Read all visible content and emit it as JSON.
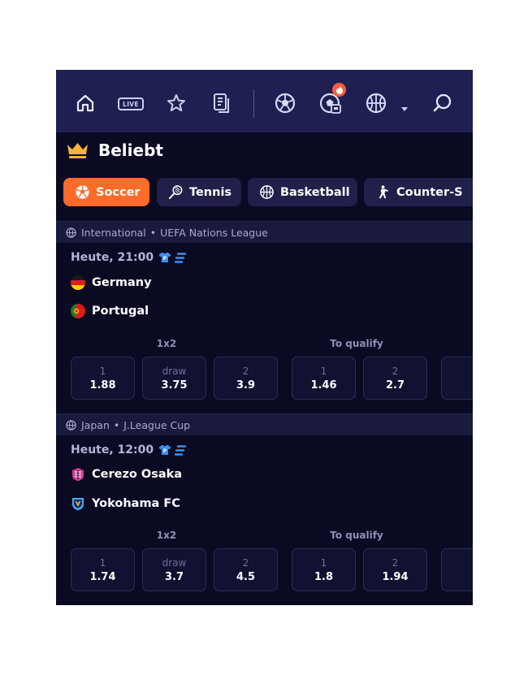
{
  "nav": {
    "live_label": "LIVE"
  },
  "popular": {
    "title": "Beliebt"
  },
  "tabs": [
    {
      "label": "Soccer",
      "icon": "soccer-ball-icon",
      "active": true
    },
    {
      "label": "Tennis",
      "icon": "tennis-icon",
      "active": false
    },
    {
      "label": "Basketball",
      "icon": "basketball-icon",
      "active": false
    },
    {
      "label": "Counter-S",
      "icon": "counter-strike-icon",
      "active": false
    }
  ],
  "matches": [
    {
      "country": "International",
      "separator": "•",
      "league": "UEFA Nations League",
      "time": "Heute, 21:00",
      "home": "Germany",
      "away": "Portugal",
      "market1": {
        "label": "1x2",
        "odds": [
          {
            "label": "1",
            "value": "1.88"
          },
          {
            "label": "draw",
            "value": "3.75"
          },
          {
            "label": "2",
            "value": "3.9"
          }
        ]
      },
      "market2": {
        "label": "To qualify",
        "odds": [
          {
            "label": "1",
            "value": "1.46"
          },
          {
            "label": "2",
            "value": "2.7"
          }
        ]
      }
    },
    {
      "country": "Japan",
      "separator": "•",
      "league": "J.League Cup",
      "time": "Heute, 12:00",
      "home": "Cerezo Osaka",
      "away": "Yokohama FC",
      "market1": {
        "label": "1x2",
        "odds": [
          {
            "label": "1",
            "value": "1.74"
          },
          {
            "label": "draw",
            "value": "3.7"
          },
          {
            "label": "2",
            "value": "4.5"
          }
        ]
      },
      "market2": {
        "label": "To qualify",
        "odds": [
          {
            "label": "1",
            "value": "1.8"
          },
          {
            "label": "2",
            "value": "1.94"
          }
        ]
      }
    }
  ],
  "colors": {
    "background": "#0a0a23",
    "nav_bg": "#1f1f52",
    "accent": "#ff6b2b",
    "badge": "#ff5a3c"
  }
}
